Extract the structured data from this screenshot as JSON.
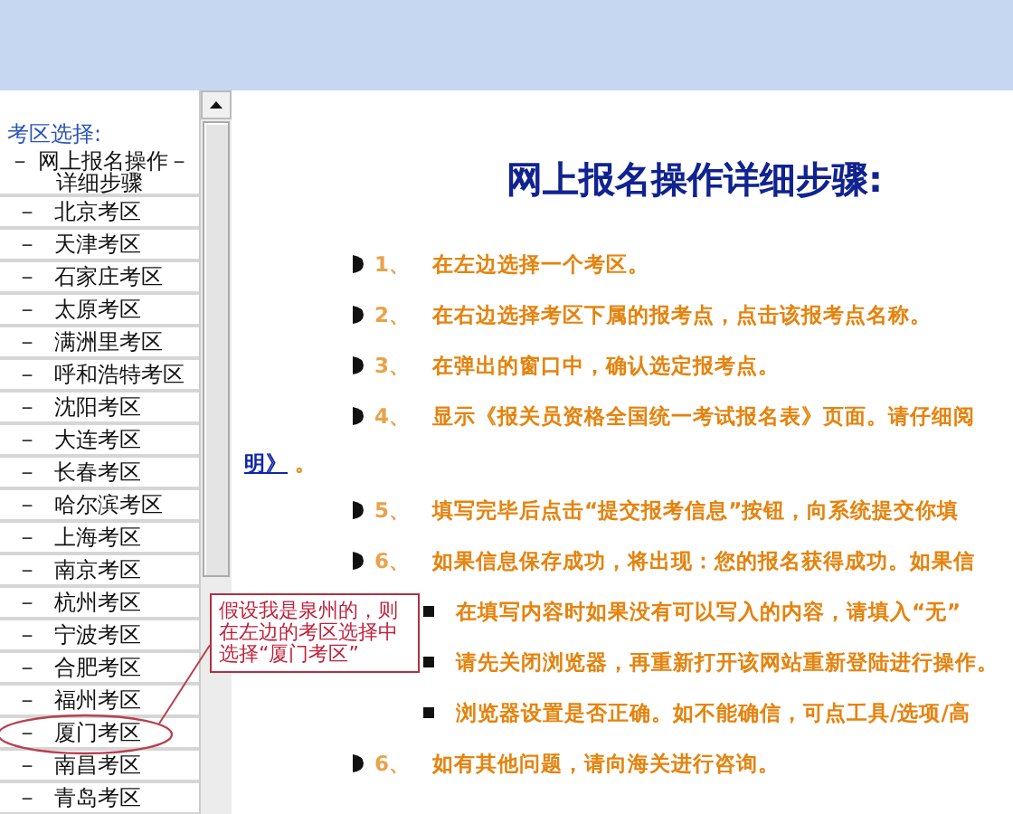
{
  "sidebar": {
    "heading": "考区选择:",
    "items": [
      {
        "kind": "page",
        "lines": [
          "－ 网上报名操作－",
          "详细步骤"
        ],
        "circled": false
      },
      {
        "kind": "region",
        "marker": "－",
        "label": "北京考区",
        "circled": false
      },
      {
        "kind": "region",
        "marker": "－",
        "label": "天津考区",
        "circled": false
      },
      {
        "kind": "region",
        "marker": "－",
        "label": "石家庄考区",
        "circled": false
      },
      {
        "kind": "region",
        "marker": "－",
        "label": "太原考区",
        "circled": false
      },
      {
        "kind": "region",
        "marker": "－",
        "label": "满洲里考区",
        "circled": false
      },
      {
        "kind": "region",
        "marker": "－",
        "label": "呼和浩特考区",
        "circled": false
      },
      {
        "kind": "region",
        "marker": "－",
        "label": "沈阳考区",
        "circled": false
      },
      {
        "kind": "region",
        "marker": "－",
        "label": "大连考区",
        "circled": false
      },
      {
        "kind": "region",
        "marker": "－",
        "label": "长春考区",
        "circled": false
      },
      {
        "kind": "region",
        "marker": "－",
        "label": "哈尔滨考区",
        "circled": false
      },
      {
        "kind": "region",
        "marker": "－",
        "label": "上海考区",
        "circled": false
      },
      {
        "kind": "region",
        "marker": "－",
        "label": "南京考区",
        "circled": false
      },
      {
        "kind": "region",
        "marker": "－",
        "label": "杭州考区",
        "circled": false
      },
      {
        "kind": "region",
        "marker": "－",
        "label": "宁波考区",
        "circled": false
      },
      {
        "kind": "region",
        "marker": "－",
        "label": "合肥考区",
        "circled": false
      },
      {
        "kind": "region",
        "marker": "－",
        "label": "福州考区",
        "circled": false
      },
      {
        "kind": "region",
        "marker": "－",
        "label": "厦门考区",
        "circled": true
      },
      {
        "kind": "region",
        "marker": "－",
        "label": "南昌考区",
        "circled": false
      },
      {
        "kind": "region",
        "marker": "－",
        "label": "青岛考区",
        "circled": false
      }
    ]
  },
  "callout": {
    "text": "假设我是泉州的，则在左边的考区选择中选择“厦门考区”"
  },
  "content": {
    "title": "网上报名操作详细步骤:",
    "items": [
      {
        "kind": "step",
        "number": "1、",
        "text": "在左边选择一个考区。"
      },
      {
        "kind": "step",
        "number": "2、",
        "text": "在右边选择考区下属的报考点，点击该报考点名称。"
      },
      {
        "kind": "step",
        "number": "3、",
        "text": "在弹出的窗口中，确认选定报考点。"
      },
      {
        "kind": "step",
        "number": "4、",
        "text": "显示《报关员资格全国统一考试报名表》页面。请仔细阅"
      },
      {
        "kind": "wrap",
        "link": "明》",
        "text": "。"
      },
      {
        "kind": "step",
        "number": "5、",
        "text": "填写完毕后点击“提交报考信息”按钮，向系统提交你填"
      },
      {
        "kind": "step",
        "number": "6、",
        "text": "如果信息保存成功，将出现：您的报名获得成功。如果信"
      },
      {
        "kind": "note",
        "text": "在填写内容时如果没有可以写入的内容，请填入“无”"
      },
      {
        "kind": "note",
        "text": "请先关闭浏览器，再重新打开该网站重新登陆进行操作。"
      },
      {
        "kind": "note",
        "text": "浏览器设置是否正确。如不能确信，可点工具/选项/高"
      },
      {
        "kind": "step",
        "number": "6、",
        "text": "如有其他问题，请向海关进行咨询。"
      }
    ]
  }
}
